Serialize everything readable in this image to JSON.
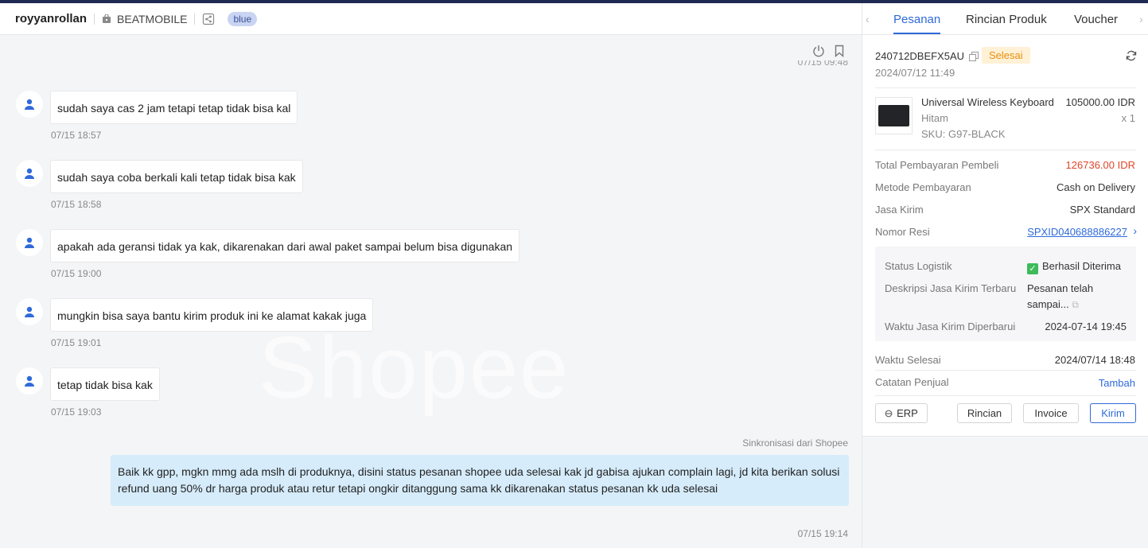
{
  "chat_header": {
    "username": "royyanrollan",
    "shop_name": "BEATMOBILE",
    "tag": "blue"
  },
  "watermark": "Shopee",
  "prev_time_cut": "07/15 09:48",
  "messages": [
    {
      "text": "sudah saya cas 2 jam tetapi tetap tidak bisa kal",
      "time": "07/15 18:57"
    },
    {
      "text": "sudah saya coba berkali kali tetap tidak bisa kak",
      "time": "07/15 18:58"
    },
    {
      "text": "apakah ada geransi tidak ya kak, dikarenakan dari awal paket sampai belum bisa digunakan",
      "time": "07/15 19:00"
    },
    {
      "text": "mungkin bisa saya bantu kirim produk ini ke alamat kakak juga",
      "time": "07/15 19:01"
    },
    {
      "text": "tetap tidak bisa kak",
      "time": "07/15 19:03"
    }
  ],
  "outgoing": {
    "sync_label": "Sinkronisasi dari Shopee",
    "text": "Baik kk gpp, mgkn mmg ada mslh di produknya, disini status pesanan shopee uda selesai kak jd gabisa ajukan complain lagi, jd kita berikan solusi refund uang 50% dr harga produk atau retur tetapi ongkir ditanggung sama kk dikarenakan status pesanan kk uda selesai",
    "time": "07/15 19:14"
  },
  "panel": {
    "tabs": [
      "Pesanan",
      "Rincian Produk",
      "Voucher"
    ],
    "order_id": "240712DBEFX5AU",
    "status": "Selesai",
    "order_date": "2024/07/12 11:49",
    "product": {
      "name": "Universal Wireless Keyboard",
      "price": "105000.00 IDR",
      "variant": "Hitam",
      "qty": "x 1",
      "sku": "SKU:  G97-BLACK"
    },
    "rows": [
      {
        "label": "Total Pembayaran Pembeli",
        "value": "126736.00 IDR"
      },
      {
        "label": "Metode Pembayaran",
        "value": "Cash on Delivery"
      },
      {
        "label": "Jasa Kirim",
        "value": "SPX Standard"
      },
      {
        "label": "Nomor Resi",
        "value": "SPXID040688886227"
      }
    ],
    "logistics": {
      "status_label": "Status Logistik",
      "status_value": "Berhasil Diterima",
      "desc_label": "Deskripsi Jasa Kirim Terbaru",
      "desc_value_1": "Pesanan telah",
      "desc_value_2": "sampai...",
      "updated_label": "Waktu Jasa Kirim Diperbarui",
      "updated_value": "2024-07-14 19:45"
    },
    "finish_label": "Waktu Selesai",
    "finish_value": "2024/07/14 18:48",
    "note_label": "Catatan Penjual",
    "note_action": "Tambah",
    "buttons": {
      "erp": "ERP",
      "detail": "Rincian",
      "invoice": "Invoice",
      "send": "Kirim"
    }
  },
  "colors": {
    "accent": "#2f6ad9",
    "status_bg": "#fff1d6",
    "status_fg": "#e8900f",
    "total_red": "#e0452a",
    "outgoing_bubble": "#d6ecfb"
  }
}
